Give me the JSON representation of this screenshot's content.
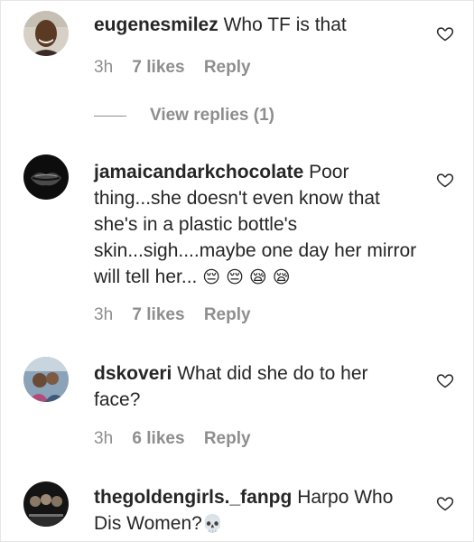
{
  "comments": [
    {
      "username": "eugenesmilez",
      "text": "Who TF is that",
      "emojis": "",
      "time": "3h",
      "likes": "7 likes",
      "reply": "Reply",
      "view_replies": "View replies (1)"
    },
    {
      "username": "jamaicandarkchocolate",
      "text": "Poor thing...she doesn't even know that she's in a plastic bottle's skin...sigh....maybe one day her mirror will tell her...",
      "emojis": "😔 😔 😪 😪",
      "time": "3h",
      "likes": "7 likes",
      "reply": "Reply"
    },
    {
      "username": "dskoveri",
      "text": "What did she do to her face?",
      "emojis": "",
      "time": "3h",
      "likes": "6 likes",
      "reply": "Reply"
    },
    {
      "username": "thegoldengirls._fanpg",
      "text": "Harpo Who Dis Women?",
      "emojis": "💀",
      "time": "",
      "likes": "",
      "reply": ""
    }
  ],
  "icons": {
    "heart": "heart-outline-icon"
  },
  "colors": {
    "text": "#262626",
    "meta": "#8e8e8e"
  }
}
